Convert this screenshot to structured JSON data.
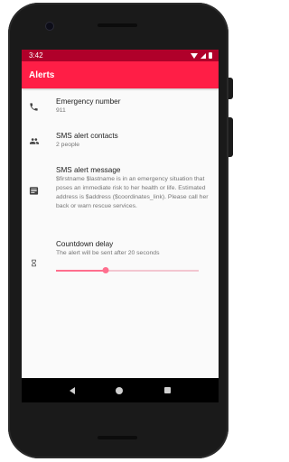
{
  "status_bar": {
    "time": "3:42"
  },
  "app_bar": {
    "title": "Alerts"
  },
  "items": [
    {
      "icon": "phone-icon",
      "title": "Emergency number",
      "subtitle": "911"
    },
    {
      "icon": "people-icon",
      "title": "SMS alert contacts",
      "subtitle": "2 people"
    },
    {
      "icon": "message-icon",
      "title": "SMS alert message",
      "subtitle": "$firstname $lastname is in an emergency situation that poses an immediate risk to her health or life. Estimated address is $address ($coordinates_link). Please call her back or warn rescue services."
    },
    {
      "icon": "hourglass-icon",
      "title": "Countdown delay",
      "subtitle": "The alert will be sent after 20 seconds"
    }
  ],
  "countdown_slider": {
    "value_fraction": 0.35
  },
  "colors": {
    "status_bar": "#b0002a",
    "app_bar": "#ff1e46",
    "slider_accent": "#ff6f8e"
  }
}
